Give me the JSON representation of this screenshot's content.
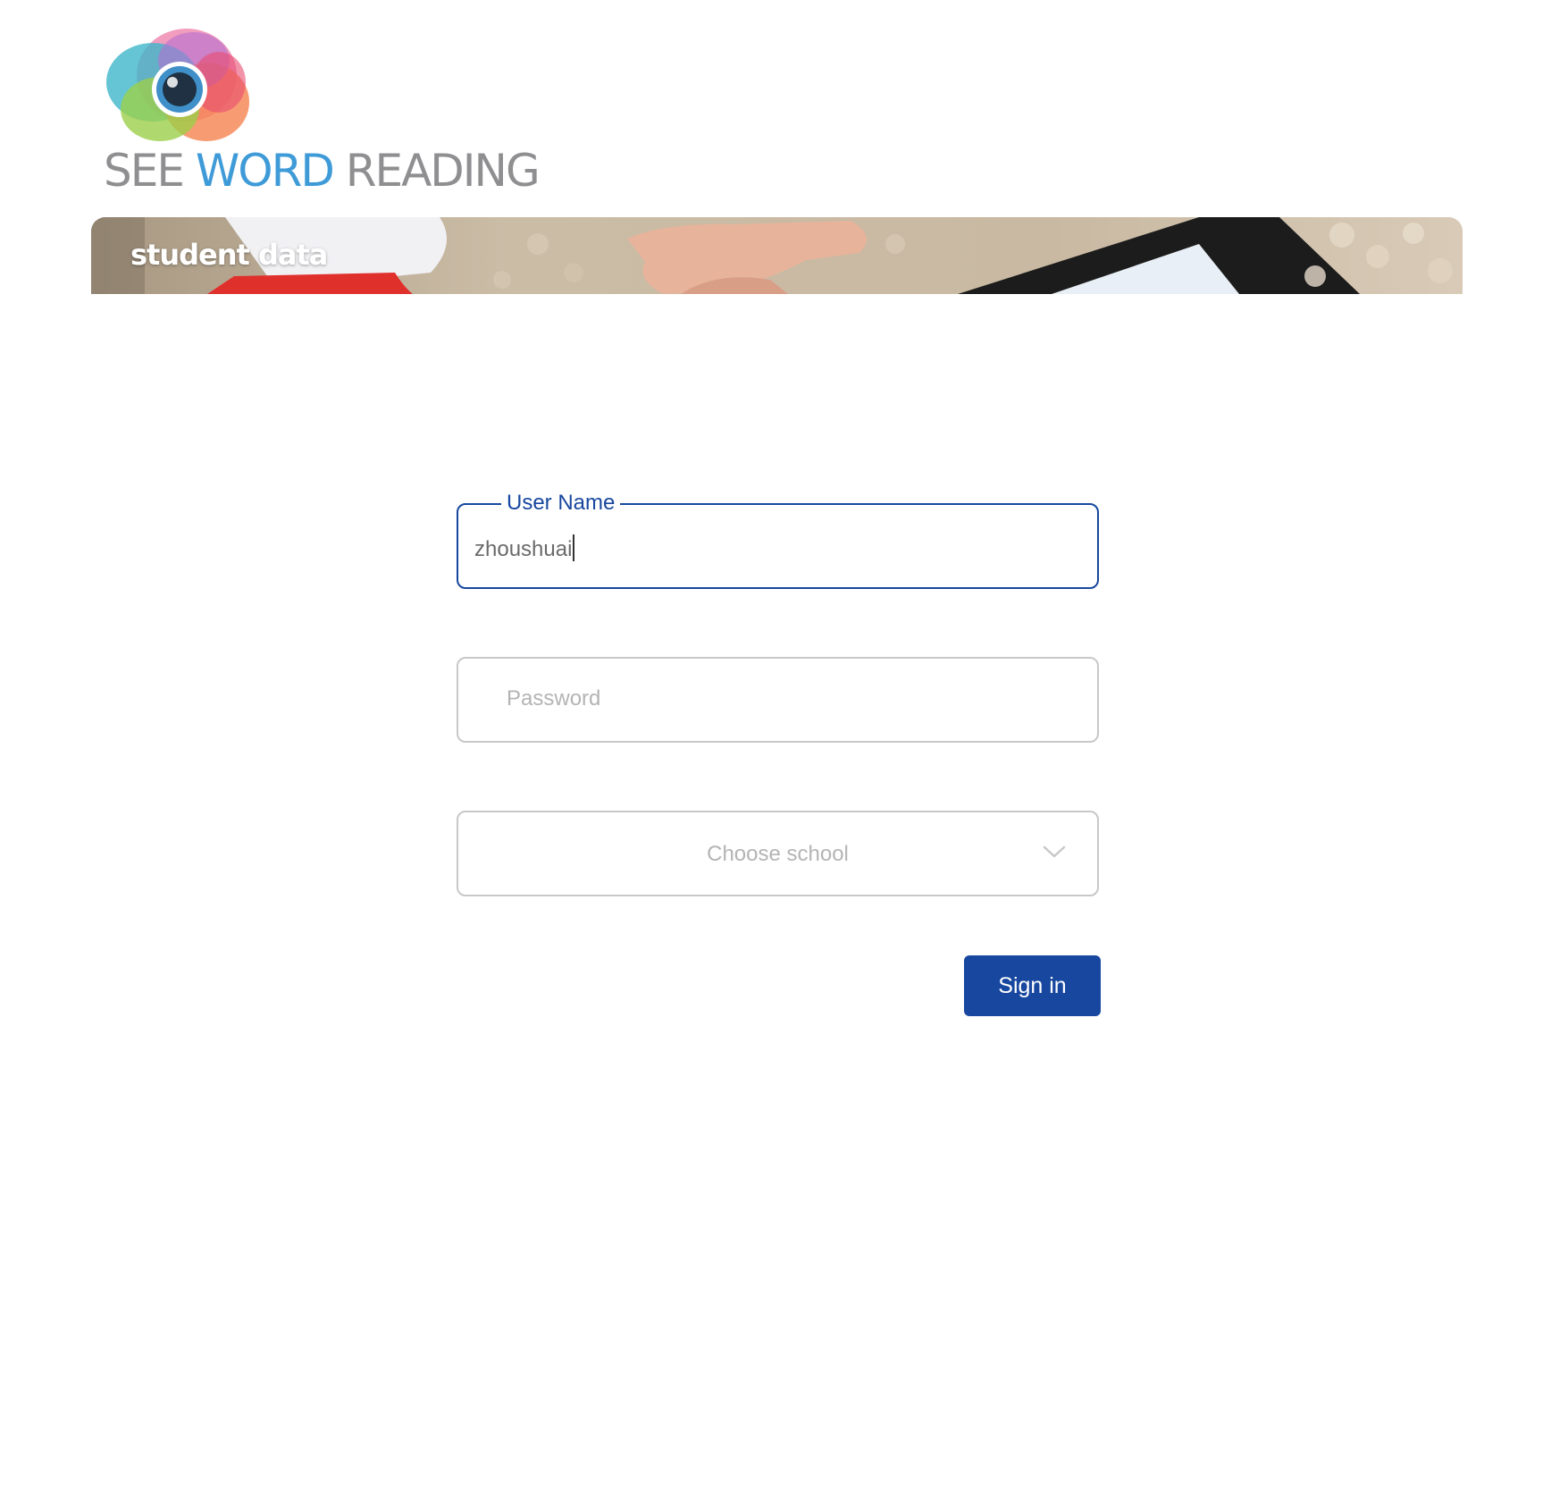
{
  "brand": {
    "logo_icon": "eye-logo-icon",
    "name_parts": {
      "see": "SEE ",
      "word": "WORD",
      "reading": " READING"
    },
    "colors": {
      "grey": "#8f8f91",
      "blue": "#3f9bd8"
    }
  },
  "banner": {
    "title": "student data"
  },
  "login_form": {
    "username": {
      "label": "User Name",
      "value": "zhoushuai",
      "focused": true
    },
    "password": {
      "placeholder": "Password"
    },
    "school_select": {
      "placeholder": "Choose school",
      "icon": "chevron-down-icon"
    },
    "sign_in_label": "Sign in"
  },
  "colors": {
    "accent": "#17479e",
    "border": "#c8c8c8",
    "placeholder": "#b4b4b4"
  }
}
